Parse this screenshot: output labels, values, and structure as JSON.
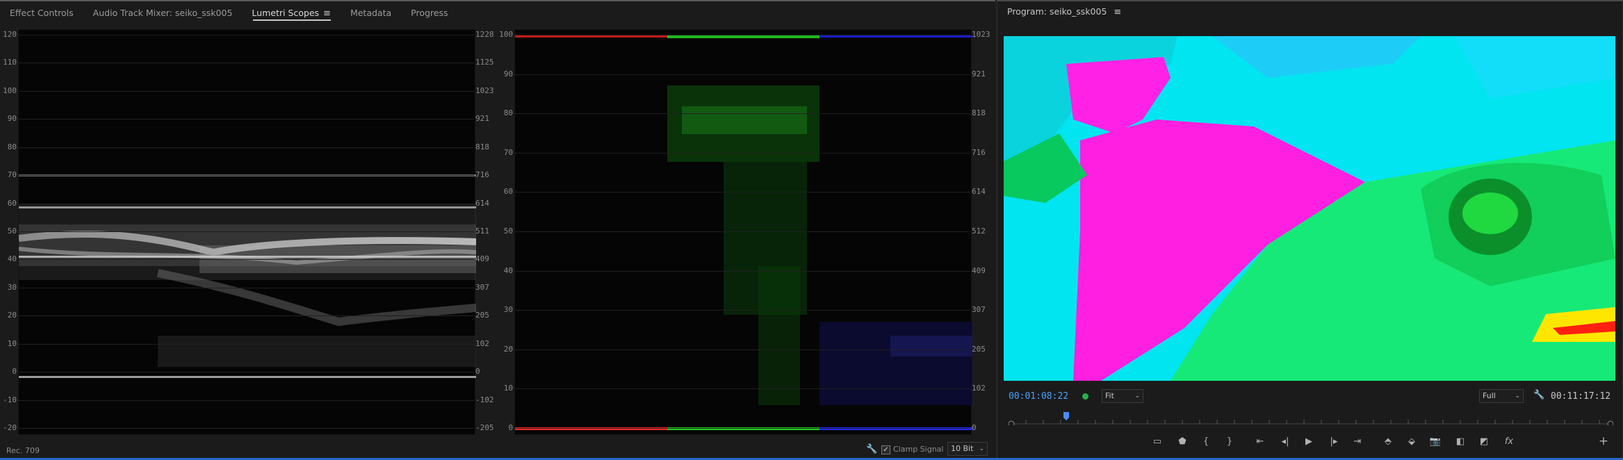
{
  "tabs": [
    {
      "label": "Effect Controls"
    },
    {
      "label": "Audio Track Mixer: seiko_ssk005"
    },
    {
      "label": "Lumetri Scopes",
      "active": true
    },
    {
      "label": "Metadata"
    },
    {
      "label": "Progress"
    }
  ],
  "tab_menu_icon": "hamburger-menu-icon",
  "waveform": {
    "left_ticks": [
      "120",
      "110",
      "100",
      "90",
      "80",
      "70",
      "60",
      "50",
      "40",
      "30",
      "20",
      "10",
      "0",
      "-10",
      "-20"
    ],
    "right_ticks": [
      "1228",
      "1125",
      "1023",
      "921",
      "818",
      "716",
      "614",
      "511",
      "409",
      "307",
      "205",
      "102",
      "0",
      "-102",
      "-205"
    ]
  },
  "parade": {
    "left_ticks": [
      "100",
      "90",
      "80",
      "70",
      "60",
      "50",
      "40",
      "30",
      "20",
      "10",
      "0"
    ],
    "right_ticks": [
      "1023",
      "921",
      "818",
      "716",
      "614",
      "512",
      "409",
      "307",
      "205",
      "102",
      "0"
    ]
  },
  "scope_status": {
    "colorspace": "Rec. 709",
    "clamp_label": "Clamp Signal",
    "clamp_checked": true,
    "bit_depth": "10 Bit",
    "wrench_icon": "wrench-icon"
  },
  "program": {
    "title": "Program: seiko_ssk005",
    "current_time": "00:01:08:22",
    "zoom": "Fit",
    "resolution": "Full",
    "duration": "00:11:17:12"
  },
  "transport": {
    "icons": [
      "safe-margins-icon",
      "add-marker-icon",
      "mark-in-icon",
      "mark-out-icon",
      "go-to-in-icon",
      "step-back-icon",
      "play-icon",
      "step-forward-icon",
      "go-to-out-icon",
      "lift-icon",
      "extract-icon",
      "export-frame-icon",
      "comparison-view-icon",
      "toggle-proxies-icon",
      "fx-icon",
      "add-button-icon"
    ]
  },
  "colors": {
    "accent": "#2f7de1",
    "timecode_blue": "#4aa0ff",
    "timecode_gray": "#c9c9c9",
    "green_dot": "#27b14a"
  }
}
